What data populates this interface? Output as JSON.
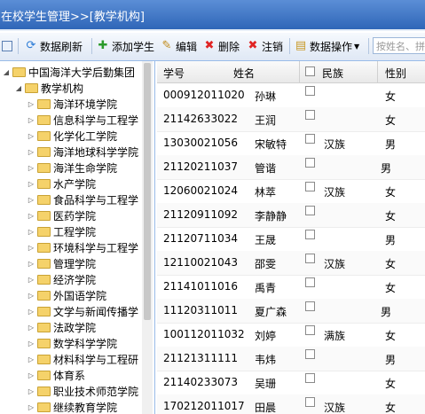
{
  "title": "在校学生管理>>[教学机构]",
  "toolbar": {
    "refresh": "数据刷新",
    "add": "添加学生",
    "edit": "编辑",
    "delete": "删除",
    "cancel": "注销",
    "ops": "数据操作",
    "search_placeholder": "按姓名、拼"
  },
  "tree": {
    "root": "中国海洋大学后勤集团",
    "group": "教学机构",
    "items": [
      "海洋环境学院",
      "信息科学与工程学",
      "化学化工学院",
      "海洋地球科学学院",
      "海洋生命学院",
      "水产学院",
      "食品科学与工程学",
      "医药学院",
      "工程学院",
      "环境科学与工程学",
      "管理学院",
      "经济学院",
      "外国语学院",
      "文学与新闻传播学",
      "法政学院",
      "数学科学学院",
      "材料科学与工程研",
      "体育系",
      "职业技术师范学院",
      "继续教育学院"
    ]
  },
  "grid": {
    "headers": {
      "id": "学号",
      "name": "姓名",
      "ethnic": "民族",
      "gender": "性别"
    },
    "rows": [
      {
        "id": "000912011020",
        "name": "孙琳",
        "ethnic": "",
        "gender": "女"
      },
      {
        "id": "21142633022",
        "name": "王润",
        "ethnic": "",
        "gender": "女"
      },
      {
        "id": "13030021056",
        "name": "宋敏特",
        "ethnic": "汉族",
        "gender": "男"
      },
      {
        "id": "21120211037",
        "name": "管谐",
        "ethnic": "",
        "gender": "男"
      },
      {
        "id": "12060021024",
        "name": "林萃",
        "ethnic": "汉族",
        "gender": "女"
      },
      {
        "id": "21120911092",
        "name": "李静静",
        "ethnic": "",
        "gender": "女"
      },
      {
        "id": "21120711034",
        "name": "王晟",
        "ethnic": "",
        "gender": "男"
      },
      {
        "id": "12110021043",
        "name": "邵雯",
        "ethnic": "汉族",
        "gender": "女"
      },
      {
        "id": "21141011016",
        "name": "禹青",
        "ethnic": "",
        "gender": "女"
      },
      {
        "id": "11120311011",
        "name": "夏广森",
        "ethnic": "",
        "gender": "男"
      },
      {
        "id": "100112011032",
        "name": "刘婷",
        "ethnic": "满族",
        "gender": "女"
      },
      {
        "id": "21121311111",
        "name": "韦炜",
        "ethnic": "",
        "gender": "男"
      },
      {
        "id": "21140233073",
        "name": "吴珊",
        "ethnic": "",
        "gender": "女"
      },
      {
        "id": "170212011017",
        "name": "田晨",
        "ethnic": "汉族",
        "gender": "女"
      }
    ]
  }
}
